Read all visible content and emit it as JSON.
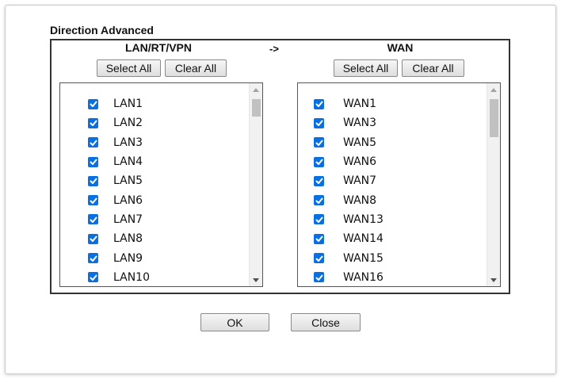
{
  "title": "Direction Advanced",
  "direction_arrow": "->",
  "left": {
    "heading": "LAN/RT/VPN",
    "select_all": "Select All",
    "clear_all": "Clear All",
    "items": [
      {
        "label": "LAN1",
        "checked": true
      },
      {
        "label": "LAN2",
        "checked": true
      },
      {
        "label": "LAN3",
        "checked": true
      },
      {
        "label": "LAN4",
        "checked": true
      },
      {
        "label": "LAN5",
        "checked": true
      },
      {
        "label": "LAN6",
        "checked": true
      },
      {
        "label": "LAN7",
        "checked": true
      },
      {
        "label": "LAN8",
        "checked": true
      },
      {
        "label": "LAN9",
        "checked": true
      },
      {
        "label": "LAN10",
        "checked": true
      }
    ]
  },
  "right": {
    "heading": "WAN",
    "select_all": "Select All",
    "clear_all": "Clear All",
    "items": [
      {
        "label": "WAN1",
        "checked": true
      },
      {
        "label": "WAN3",
        "checked": true
      },
      {
        "label": "WAN5",
        "checked": true
      },
      {
        "label": "WAN6",
        "checked": true
      },
      {
        "label": "WAN7",
        "checked": true
      },
      {
        "label": "WAN8",
        "checked": true
      },
      {
        "label": "WAN13",
        "checked": true
      },
      {
        "label": "WAN14",
        "checked": true
      },
      {
        "label": "WAN15",
        "checked": true
      },
      {
        "label": "WAN16",
        "checked": true
      }
    ]
  },
  "buttons": {
    "ok": "OK",
    "close": "Close"
  },
  "colors": {
    "checkbox": "#0a6fe0",
    "border": "#333333"
  }
}
